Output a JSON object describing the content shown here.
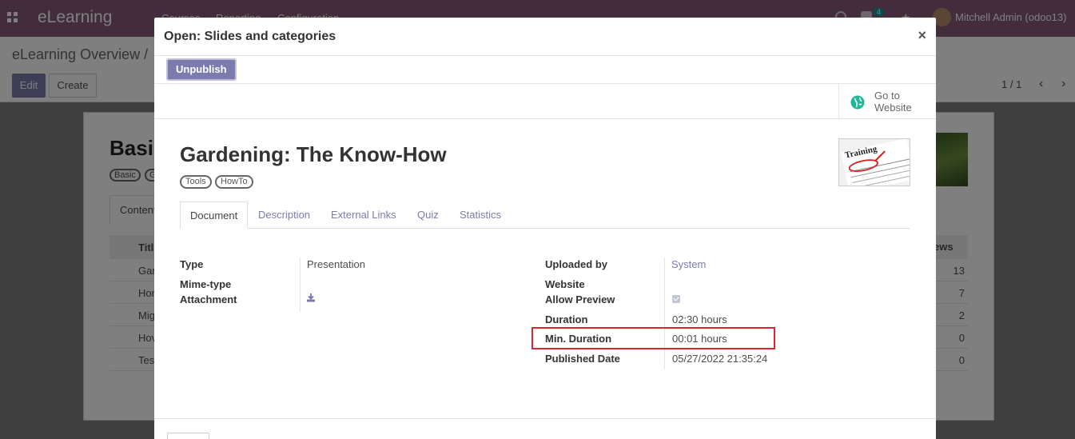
{
  "app": {
    "brand": "eLearning",
    "menu": [
      "Courses",
      "Reporting",
      "Configuration"
    ],
    "user": "Mitchell Admin (odoo13)",
    "message_count": "4",
    "breadcrumb": "eLearning Overview /",
    "edit_label": "Edit",
    "create_label": "Create",
    "pager": "1 / 1",
    "background_title": "Basi",
    "background_tags": [
      "Basic",
      "G"
    ],
    "background_tab": "Content",
    "background_col_title": "Titl",
    "background_col_views": "ews",
    "background_rows": [
      {
        "title": "Gar",
        "views": "13"
      },
      {
        "title": "Hor",
        "views": "7"
      },
      {
        "title": "Mig",
        "views": "2"
      },
      {
        "title": "Hov",
        "views": "0"
      },
      {
        "title": "Tes",
        "views": "0"
      }
    ]
  },
  "modal": {
    "title": "Open: Slides and categories",
    "close_glyph": "×",
    "unpublish_label": "Unpublish",
    "website_button": [
      "Go to",
      "Website"
    ],
    "record_name": "Gardening: The Know-How",
    "tags": [
      "Tools",
      "HowTo"
    ],
    "thumbnail_text": "Training",
    "tabs": [
      "Document",
      "Description",
      "External Links",
      "Quiz",
      "Statistics"
    ],
    "left_fields": {
      "type_label": "Type",
      "type_value": "Presentation",
      "mimetype_label": "Mime-type",
      "attachment_label": "Attachment"
    },
    "right_fields": {
      "uploaded_by_label": "Uploaded by",
      "uploaded_by_value": "System",
      "website_label": "Website",
      "allow_preview_label": "Allow Preview",
      "allow_preview_checked": true,
      "duration_label": "Duration",
      "duration_value": "02:30 hours",
      "min_duration_label": "Min. Duration",
      "min_duration_value": "00:01 hours",
      "published_date_label": "Published Date",
      "published_date_value": "05/27/2022 21:35:24"
    }
  },
  "colors": {
    "navbar": "#875a7b",
    "primary": "#7c7bad",
    "highlight_box": "#e0232e",
    "globe": "#21b799"
  },
  "icons": [
    "apps-icon",
    "clock-icon",
    "chat-icon",
    "star-icon",
    "chevron-left-icon",
    "chevron-right-icon",
    "close-icon",
    "globe-icon",
    "download-icon",
    "checkbox-checked-icon"
  ]
}
